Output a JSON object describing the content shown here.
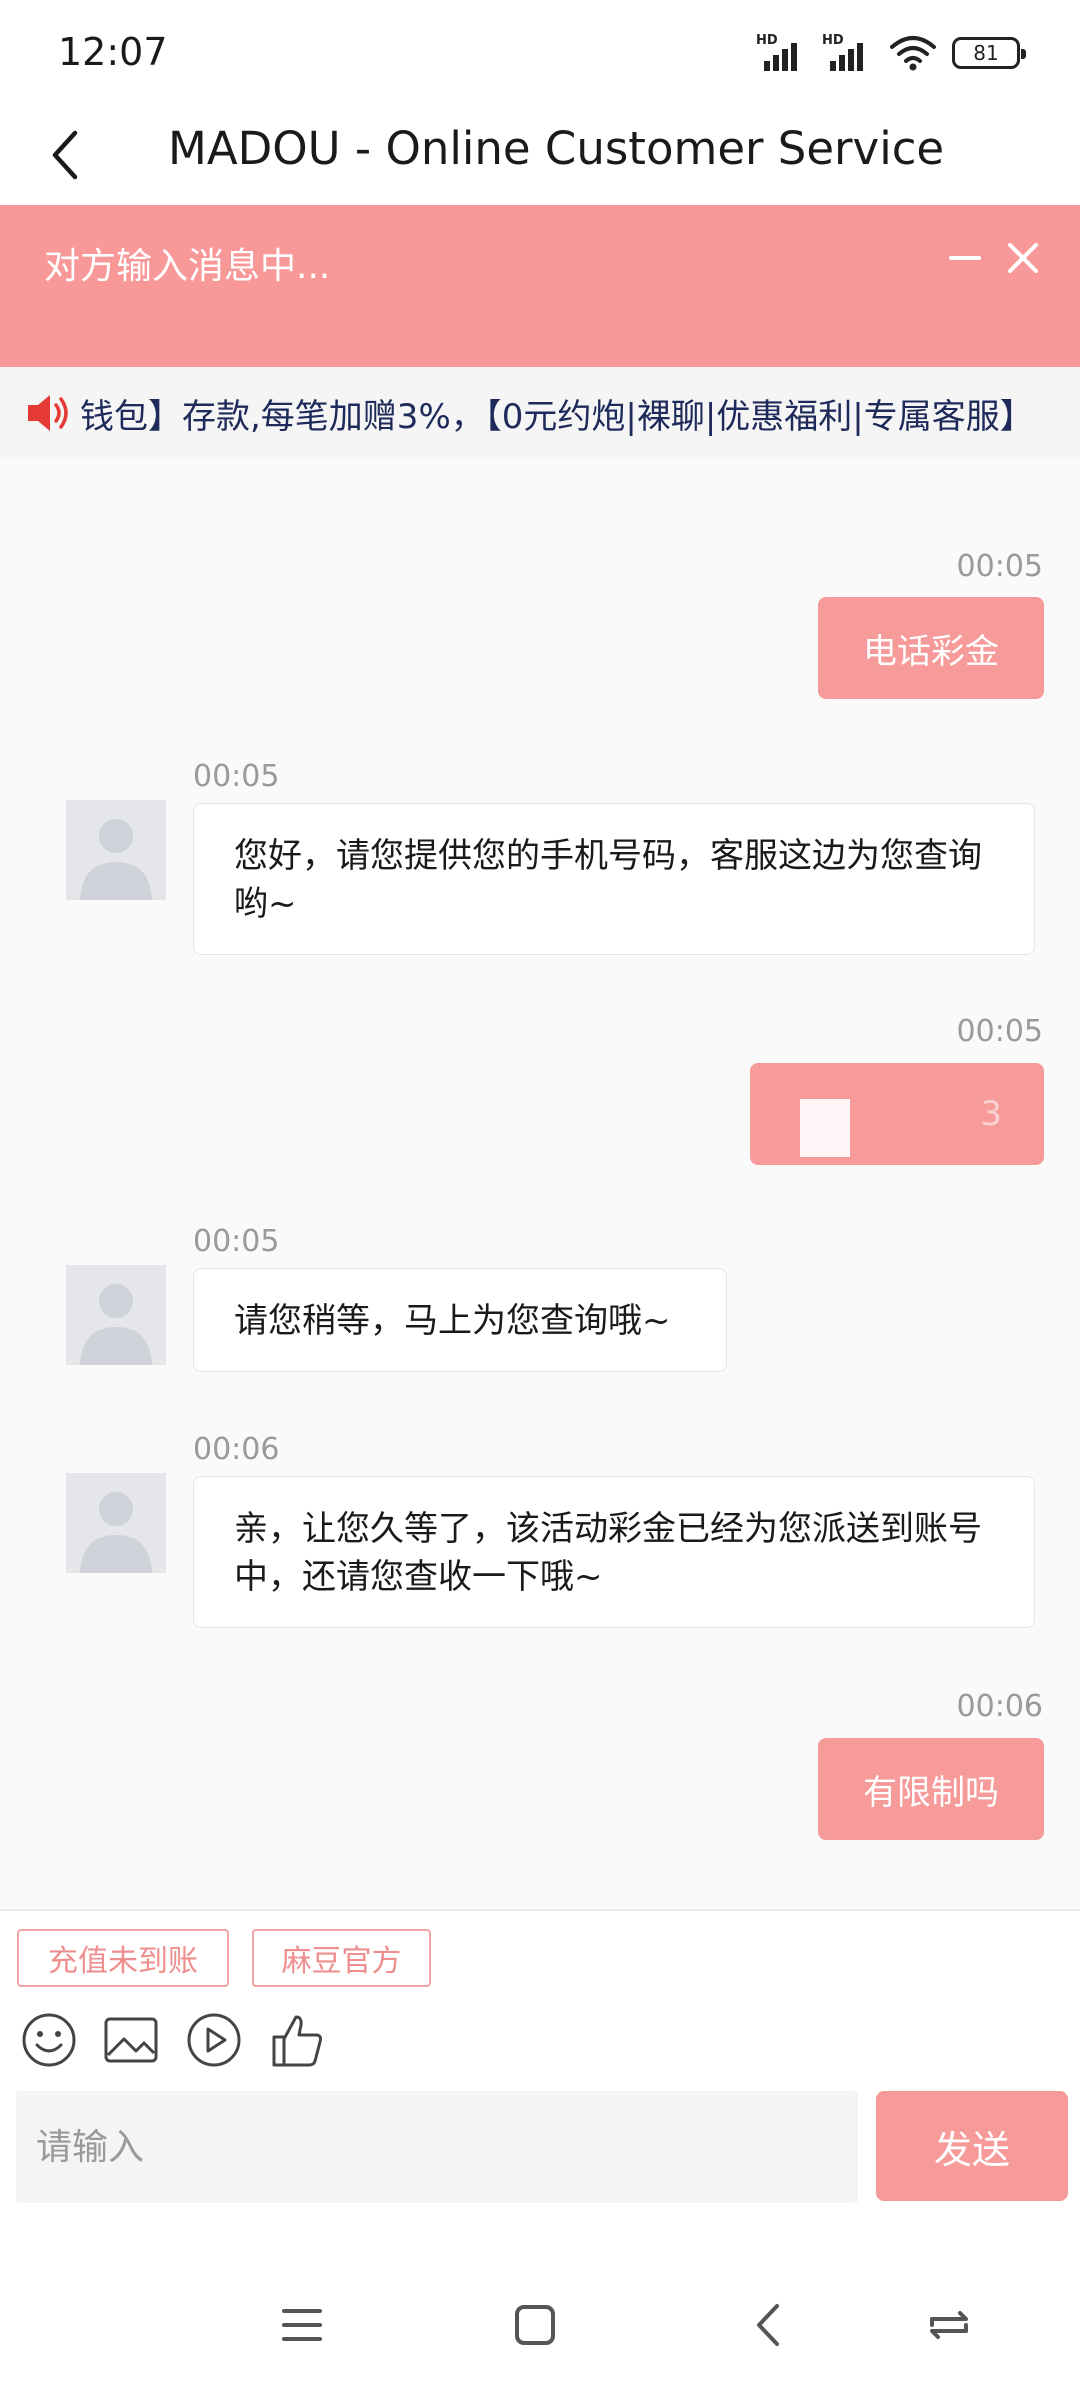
{
  "status_bar": {
    "time": "12:07",
    "battery": "81",
    "signal_label": "HD"
  },
  "header": {
    "title": "MADOU - Online Customer Service"
  },
  "typing_banner": {
    "text": "对方输入消息中..."
  },
  "notice": {
    "text": "钱包】存款,每笔加赠3%，【0元约炮|裸聊|优惠福利|专属客服】"
  },
  "messages": [
    {
      "side": "out",
      "time": "00:05",
      "text": "电话彩金"
    },
    {
      "side": "in",
      "time": "00:05",
      "text": "您好，请您提供您的手机号码，客服这边为您查询哟~"
    },
    {
      "side": "out",
      "time": "00:05",
      "text": "3",
      "redacted": true
    },
    {
      "side": "in",
      "time": "00:05",
      "text": "请您稍等，马上为您查询哦~"
    },
    {
      "side": "in",
      "time": "00:06",
      "text": "亲，让您久等了，该活动彩金已经为您派送到账号中，还请您查收一下哦~"
    },
    {
      "side": "out",
      "time": "00:06",
      "text": "有限制吗"
    }
  ],
  "quick_replies": [
    "充值未到账",
    "麻豆官方"
  ],
  "input": {
    "placeholder": "请输入",
    "value": ""
  },
  "send_label": "发送",
  "colors": {
    "accent": "#f79a9a",
    "banner": "#f89898"
  }
}
